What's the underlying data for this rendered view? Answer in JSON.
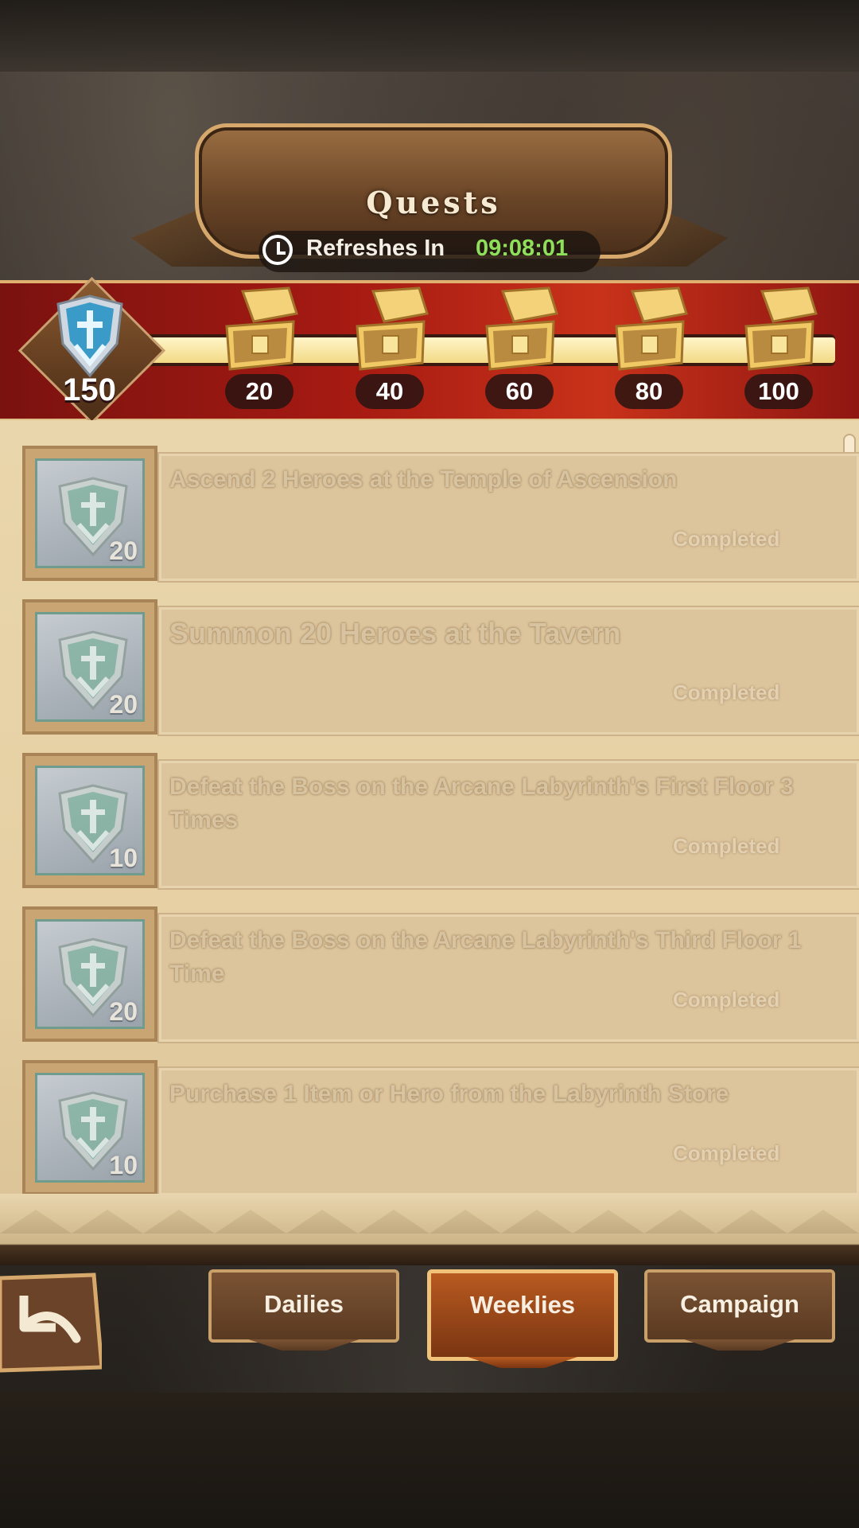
{
  "header": {
    "title": "Quests",
    "refresh_label": "Refreshes In",
    "refresh_time": "09:08:01",
    "refresh_time_color": "#8ee05a"
  },
  "progress": {
    "current_points": "150",
    "fill_fraction": 1.0,
    "milestones": [
      {
        "points": "20",
        "icon": "treasure-chest-icon",
        "state": "opened"
      },
      {
        "points": "40",
        "icon": "treasure-chest-icon",
        "state": "opened"
      },
      {
        "points": "60",
        "icon": "treasure-chest-icon",
        "state": "opened"
      },
      {
        "points": "80",
        "icon": "treasure-chest-icon",
        "state": "opened"
      },
      {
        "points": "100",
        "icon": "treasure-chest-icon",
        "state": "opened"
      }
    ]
  },
  "quests": [
    {
      "title": "Ascend 2 Heroes at the Temple of Ascension",
      "points": "20",
      "status": "Completed"
    },
    {
      "title": "Summon 20 Heroes at the Tavern",
      "points": "20",
      "status": "Completed"
    },
    {
      "title": "Defeat the Boss on the Arcane Labyrinth's First Floor 3 Times",
      "points": "10",
      "status": "Completed"
    },
    {
      "title": "Defeat the Boss on the Arcane Labyrinth's Third Floor 1 Time",
      "points": "20",
      "status": "Completed"
    },
    {
      "title": "Purchase 1 Item or Hero from the Labyrinth Store",
      "points": "10",
      "status": "Completed"
    }
  ],
  "nav": {
    "back_icon": "back-arrow-icon",
    "tabs": [
      {
        "label": "Dailies",
        "active": false
      },
      {
        "label": "Weeklies",
        "active": true
      },
      {
        "label": "Campaign",
        "active": false
      }
    ]
  },
  "colors": {
    "accent_red": "#a51a12",
    "panel": "#e6d0a4",
    "active_tab": "#b85a20"
  }
}
